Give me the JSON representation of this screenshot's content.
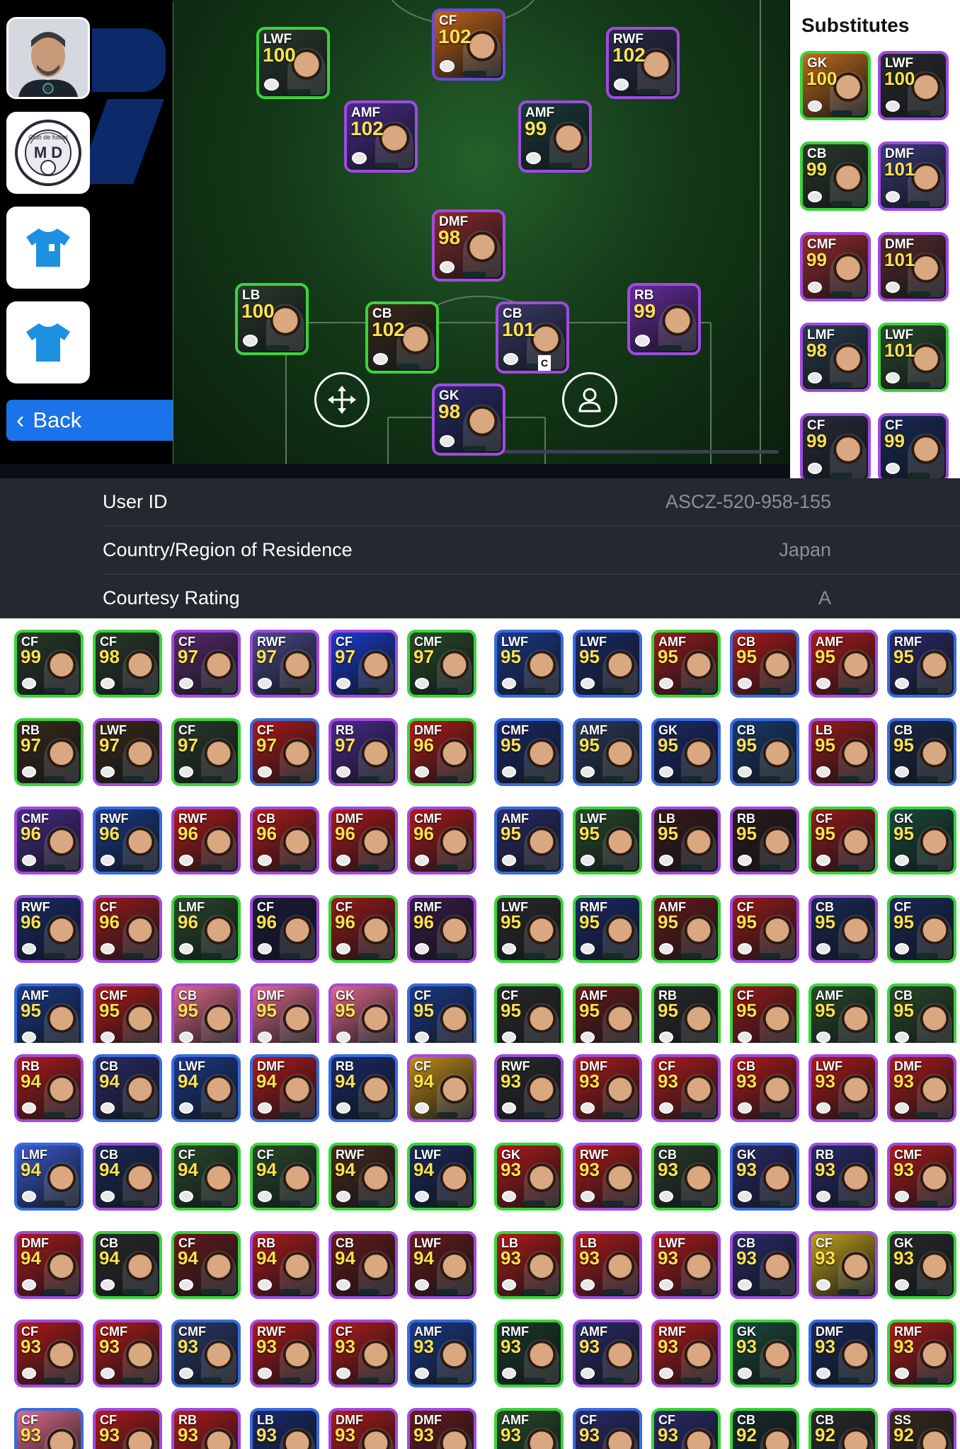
{
  "left_menu": {
    "coach_name": "",
    "club_emblem_text": "M D",
    "club_emblem_ring": "Club de futbol",
    "back_label": "Back"
  },
  "lineup": {
    "captain_mark": "C",
    "starters": [
      {
        "pos": "CF",
        "ovr": "102",
        "border": "#6a4bd8",
        "bg": "#c2621a"
      },
      {
        "pos": "LWF",
        "ovr": "100",
        "border": "#3ad43a",
        "bg": "#2a3a2a"
      },
      {
        "pos": "RWF",
        "ovr": "102",
        "border": "#a04be0",
        "bg": "#2a2a4a"
      },
      {
        "pos": "AMF",
        "ovr": "102",
        "border": "#a04be0",
        "bg": "#4a2a8a"
      },
      {
        "pos": "AMF",
        "ovr": "99",
        "border": "#a04be0",
        "bg": "#1a3a3a"
      },
      {
        "pos": "DMF",
        "ovr": "98",
        "border": "#a04be0",
        "bg": "#8a2a2a"
      },
      {
        "pos": "LB",
        "ovr": "100",
        "border": "#3ad43a",
        "bg": "#2a3a2a"
      },
      {
        "pos": "CB",
        "ovr": "102",
        "border": "#3ad43a",
        "bg": "#3a2a1a"
      },
      {
        "pos": "CB",
        "ovr": "101",
        "border": "#a04be0",
        "bg": "#3a3a6a"
      },
      {
        "pos": "RB",
        "ovr": "99",
        "border": "#a04be0",
        "bg": "#6a2aa0"
      },
      {
        "pos": "GK",
        "ovr": "98",
        "border": "#a04be0",
        "bg": "#2a2a6a"
      }
    ]
  },
  "substitutes": {
    "title": "Substitutes",
    "players": [
      {
        "pos": "GK",
        "ovr": "100",
        "border": "#3ad43a",
        "bg": "#c06a1a"
      },
      {
        "pos": "LWF",
        "ovr": "100",
        "border": "#a04be0",
        "bg": "#2a2a2a"
      },
      {
        "pos": "CB",
        "ovr": "99",
        "border": "#3ad43a",
        "bg": "#2a3a2a"
      },
      {
        "pos": "DMF",
        "ovr": "101",
        "border": "#a04be0",
        "bg": "#3a3a7a"
      },
      {
        "pos": "CMF",
        "ovr": "99",
        "border": "#a04be0",
        "bg": "#9a2a2a"
      },
      {
        "pos": "DMF",
        "ovr": "101",
        "border": "#a04be0",
        "bg": "#5a2a2a"
      },
      {
        "pos": "LMF",
        "ovr": "98",
        "border": "#a04be0",
        "bg": "#2a3a4a"
      },
      {
        "pos": "LWF",
        "ovr": "101",
        "border": "#3ad43a",
        "bg": "#2a4a2a"
      },
      {
        "pos": "CF",
        "ovr": "99",
        "border": "#a04be0",
        "bg": "#2a2a3a"
      },
      {
        "pos": "CF",
        "ovr": "99",
        "border": "#a04be0",
        "bg": "#1a2a5a"
      }
    ]
  },
  "profile": {
    "rows": [
      {
        "label": "User ID",
        "value": "ASCZ-520-958-155"
      },
      {
        "label": "Country/Region of Residence",
        "value": "Japan"
      },
      {
        "label": "Courtesy Rating",
        "value": "A"
      }
    ]
  },
  "collection_a": {
    "rows": [
      [
        [
          "CF",
          "99",
          "#2a3a2a",
          "#3ad43a"
        ],
        [
          "CF",
          "98",
          "#2a3a2a",
          "#3ad43a"
        ],
        [
          "CF",
          "97",
          "#5a2a6a",
          "#a04be0"
        ],
        [
          "RWF",
          "97",
          "#4a4a8a",
          "#a04be0"
        ],
        [
          "CF",
          "97",
          "#1a3ad0",
          "#a04be0"
        ],
        [
          "CMF",
          "97",
          "#2a4a2a",
          "#3ad43a"
        ],
        [
          "LWF",
          "95",
          "#1a3a8a",
          "#3a6ae0"
        ],
        [
          "LWF",
          "95",
          "#1a2a6a",
          "#3a6ae0"
        ],
        [
          "AMF",
          "95",
          "#9a1a1a",
          "#3ad43a"
        ],
        [
          "CB",
          "95",
          "#b01a1a",
          "#3a6ae0"
        ],
        [
          "AMF",
          "95",
          "#b01a1a",
          "#a04be0"
        ],
        [
          "RMF",
          "95",
          "#2a2a6a",
          "#3a6ae0"
        ]
      ],
      [
        [
          "RB",
          "97",
          "#3a2a1a",
          "#3ad43a"
        ],
        [
          "LWF",
          "97",
          "#3a2a1a",
          "#a04be0"
        ],
        [
          "CF",
          "97",
          "#2a3a2a",
          "#3ad43a"
        ],
        [
          "CF",
          "97",
          "#b01a1a",
          "#3a6ae0"
        ],
        [
          "RB",
          "97",
          "#4a2a8a",
          "#a04be0"
        ],
        [
          "DMF",
          "96",
          "#b01a1a",
          "#3ad43a"
        ],
        [
          "CMF",
          "95",
          "#1a2a6a",
          "#3a6ae0"
        ],
        [
          "AMF",
          "95",
          "#2a3a5a",
          "#3a6ae0"
        ],
        [
          "GK",
          "95",
          "#1a2a6a",
          "#3a6ae0"
        ],
        [
          "CB",
          "95",
          "#1a3a6a",
          "#3a6ae0"
        ],
        [
          "LB",
          "95",
          "#9a1a1a",
          "#a04be0"
        ],
        [
          "CB",
          "95",
          "#1a2a4a",
          "#3a6ae0"
        ]
      ],
      [
        [
          "CMF",
          "96",
          "#4a2a8a",
          "#a04be0"
        ],
        [
          "RWF",
          "96",
          "#1a3a8a",
          "#3a6ae0"
        ],
        [
          "RWF",
          "96",
          "#b01a1a",
          "#a04be0"
        ],
        [
          "CB",
          "96",
          "#b01a1a",
          "#a04be0"
        ],
        [
          "DMF",
          "96",
          "#b01a1a",
          "#a04be0"
        ],
        [
          "CMF",
          "96",
          "#b01a1a",
          "#a04be0"
        ],
        [
          "AMF",
          "95",
          "#2a2a6a",
          "#3a6ae0"
        ],
        [
          "LWF",
          "95",
          "#2a4a2a",
          "#3ad43a"
        ],
        [
          "LB",
          "95",
          "#3a1a1a",
          "#a04be0"
        ],
        [
          "RB",
          "95",
          "#2a1a1a",
          "#a04be0"
        ],
        [
          "CF",
          "95",
          "#9a1a1a",
          "#3ad43a"
        ],
        [
          "GK",
          "95",
          "#1a4a3a",
          "#3ad43a"
        ]
      ],
      [
        [
          "RWF",
          "96",
          "#1a2a6a",
          "#a04be0"
        ],
        [
          "CF",
          "96",
          "#9a1a1a",
          "#a04be0"
        ],
        [
          "LMF",
          "96",
          "#2a4a2a",
          "#3ad43a"
        ],
        [
          "CF",
          "96",
          "#1a1a3a",
          "#a04be0"
        ],
        [
          "CF",
          "96",
          "#9a1a1a",
          "#3ad43a"
        ],
        [
          "RMF",
          "96",
          "#3a1a4a",
          "#a04be0"
        ],
        [
          "LWF",
          "95",
          "#2a2a2a",
          "#3ad43a"
        ],
        [
          "RMF",
          "95",
          "#1a2a6a",
          "#3ad43a"
        ],
        [
          "AMF",
          "95",
          "#6a1a1a",
          "#3ad43a"
        ],
        [
          "CF",
          "95",
          "#9a1a1a",
          "#a04be0"
        ],
        [
          "CB",
          "95",
          "#1a2a5a",
          "#a04be0"
        ],
        [
          "CF",
          "95",
          "#1a2a5a",
          "#3ad43a"
        ]
      ],
      [
        [
          "AMF",
          "95",
          "#1a3a8a",
          "#3a6ae0"
        ],
        [
          "CMF",
          "95",
          "#b01a1a",
          "#a04be0"
        ],
        [
          "CB",
          "95",
          "#e06a8a",
          "#a04be0"
        ],
        [
          "DMF",
          "95",
          "#e06a8a",
          "#a04be0"
        ],
        [
          "GK",
          "95",
          "#e06a8a",
          "#a04be0"
        ],
        [
          "CF",
          "95",
          "#1a3a8a",
          "#3a6ae0"
        ],
        [
          "CF",
          "95",
          "#2a2a2a",
          "#3ad43a"
        ],
        [
          "AMF",
          "95",
          "#6a1a1a",
          "#3ad43a"
        ],
        [
          "RB",
          "95",
          "#2a2a2a",
          "#3ad43a"
        ],
        [
          "CF",
          "95",
          "#9a1a1a",
          "#3ad43a"
        ],
        [
          "AMF",
          "95",
          "#2a4a2a",
          "#3ad43a"
        ],
        [
          "CB",
          "95",
          "#2a4a2a",
          "#3ad43a"
        ]
      ]
    ]
  },
  "collection_b": {
    "rows": [
      [
        [
          "RB",
          "94",
          "#b01a1a",
          "#a04be0"
        ],
        [
          "CB",
          "94",
          "#2a2a6a",
          "#3a6ae0"
        ],
        [
          "LWF",
          "94",
          "#1a3a8a",
          "#3a6ae0"
        ],
        [
          "DMF",
          "94",
          "#b01a1a",
          "#3a6ae0"
        ],
        [
          "RB",
          "94",
          "#1a2a6a",
          "#3a6ae0"
        ],
        [
          "CF",
          "94",
          "#c08a1a",
          "#a04be0"
        ],
        [
          "RWF",
          "93",
          "#2a2a2a",
          "#a04be0"
        ],
        [
          "DMF",
          "93",
          "#b01a1a",
          "#a04be0"
        ],
        [
          "CF",
          "93",
          "#b01a1a",
          "#a04be0"
        ],
        [
          "CB",
          "93",
          "#b01a1a",
          "#a04be0"
        ],
        [
          "LWF",
          "93",
          "#b01a1a",
          "#a04be0"
        ],
        [
          "DMF",
          "93",
          "#b01a1a",
          "#a04be0"
        ]
      ],
      [
        [
          "LMF",
          "94",
          "#3a5ad0",
          "#3a6ae0"
        ],
        [
          "CB",
          "94",
          "#1a2a5a",
          "#a04be0"
        ],
        [
          "CF",
          "94",
          "#2a4a2a",
          "#3ad43a"
        ],
        [
          "CF",
          "94",
          "#2a4a2a",
          "#3ad43a"
        ],
        [
          "RWF",
          "94",
          "#4a2a1a",
          "#3ad43a"
        ],
        [
          "LWF",
          "94",
          "#1a2a5a",
          "#3ad43a"
        ],
        [
          "GK",
          "93",
          "#b01a1a",
          "#3ad43a"
        ],
        [
          "RWF",
          "93",
          "#b01a1a",
          "#a04be0"
        ],
        [
          "CB",
          "93",
          "#2a3a2a",
          "#3ad43a"
        ],
        [
          "GK",
          "93",
          "#2a2a6a",
          "#3a6ae0"
        ],
        [
          "RB",
          "93",
          "#2a2a6a",
          "#a04be0"
        ],
        [
          "CMF",
          "93",
          "#b01a1a",
          "#a04be0"
        ]
      ],
      [
        [
          "DMF",
          "94",
          "#b01a1a",
          "#a04be0"
        ],
        [
          "CB",
          "94",
          "#2a2a2a",
          "#3ad43a"
        ],
        [
          "CF",
          "94",
          "#6a1a1a",
          "#3ad43a"
        ],
        [
          "RB",
          "94",
          "#b01a1a",
          "#a04be0"
        ],
        [
          "CB",
          "94",
          "#6a1a1a",
          "#a04be0"
        ],
        [
          "LWF",
          "94",
          "#6a1a1a",
          "#a04be0"
        ],
        [
          "LB",
          "93",
          "#b01a1a",
          "#3ad43a"
        ],
        [
          "LB",
          "93",
          "#b01a1a",
          "#a04be0"
        ],
        [
          "LWF",
          "93",
          "#b01a1a",
          "#a04be0"
        ],
        [
          "CB",
          "93",
          "#2a2a6a",
          "#a04be0"
        ],
        [
          "CF",
          "93",
          "#c0a01a",
          "#a04be0"
        ],
        [
          "GK",
          "93",
          "#2a2a2a",
          "#3ad43a"
        ]
      ],
      [
        [
          "CF",
          "93",
          "#b01a1a",
          "#a04be0"
        ],
        [
          "CMF",
          "93",
          "#b01a1a",
          "#a04be0"
        ],
        [
          "CMF",
          "93",
          "#2a3a6a",
          "#3a6ae0"
        ],
        [
          "RWF",
          "93",
          "#b01a1a",
          "#a04be0"
        ],
        [
          "CF",
          "93",
          "#b01a1a",
          "#a04be0"
        ],
        [
          "AMF",
          "93",
          "#1a3a8a",
          "#3a6ae0"
        ],
        [
          "RMF",
          "93",
          "#1a3a2a",
          "#3ad43a"
        ],
        [
          "AMF",
          "93",
          "#2a2a6a",
          "#a04be0"
        ],
        [
          "RMF",
          "93",
          "#b01a1a",
          "#a04be0"
        ],
        [
          "GK",
          "93",
          "#1a4a3a",
          "#3ad43a"
        ],
        [
          "DMF",
          "93",
          "#1a2a5a",
          "#3a6ae0"
        ],
        [
          "RMF",
          "93",
          "#b01a1a",
          "#3ad43a"
        ]
      ],
      [
        [
          "CF",
          "93",
          "#e06a8a",
          "#3a6ae0"
        ],
        [
          "CF",
          "93",
          "#b01a1a",
          "#a04be0"
        ],
        [
          "RB",
          "93",
          "#b01a1a",
          "#a04be0"
        ],
        [
          "LB",
          "93",
          "#1a2a6a",
          "#3a6ae0"
        ],
        [
          "DMF",
          "93",
          "#b01a1a",
          "#a04be0"
        ],
        [
          "DMF",
          "93",
          "#6a1a1a",
          "#a04be0"
        ],
        [
          "AMF",
          "93",
          "#2a4a2a",
          "#3ad43a"
        ],
        [
          "CF",
          "93",
          "#2a2a6a",
          "#3a6ae0"
        ],
        [
          "CF",
          "93",
          "#2a2a6a",
          "#3ad43a"
        ],
        [
          "CB",
          "92",
          "#1a2a2a",
          "#3ad43a"
        ],
        [
          "CB",
          "92",
          "#2a2a2a",
          "#3ad43a"
        ],
        [
          "SS",
          "92",
          "#3a2a1a",
          "#a04be0"
        ]
      ]
    ]
  }
}
